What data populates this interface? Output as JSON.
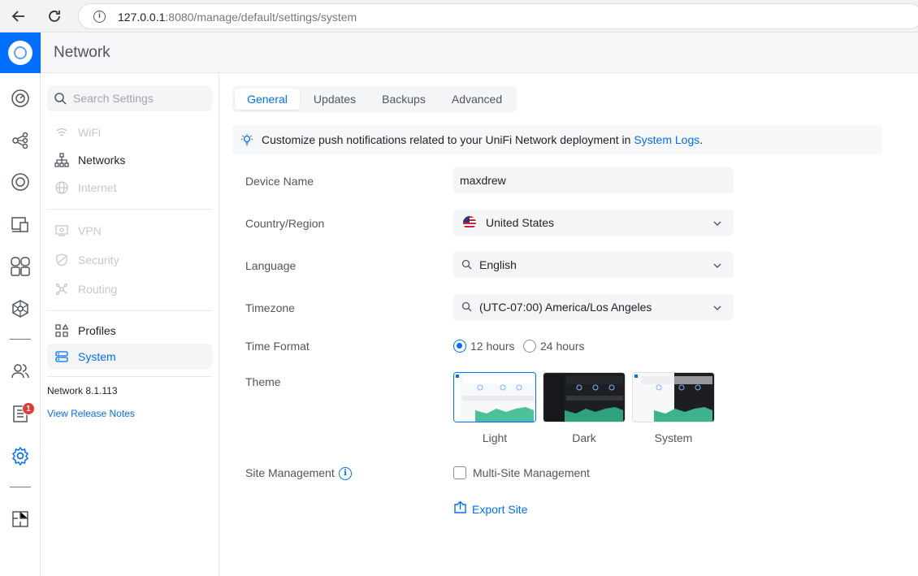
{
  "browser": {
    "url_host": "127.0.0.1",
    "url_rest": ":8080/manage/default/settings/system"
  },
  "header": {
    "title": "Network"
  },
  "rail": {
    "icons": [
      "dashboard-icon",
      "topology-icon",
      "clients-target-icon",
      "devices-icon",
      "insights-icon",
      "integrations-icon",
      "admins-icon",
      "system-log-icon",
      "settings-icon",
      "innerspace-icon"
    ],
    "notification_count": "1"
  },
  "sidebar": {
    "search_placeholder": "Search Settings",
    "items": [
      {
        "label": "WiFi",
        "state": "disabled"
      },
      {
        "label": "Networks",
        "state": "normal"
      },
      {
        "label": "Internet",
        "state": "disabled"
      },
      {
        "label": "VPN",
        "state": "disabled"
      },
      {
        "label": "Security",
        "state": "disabled"
      },
      {
        "label": "Routing",
        "state": "disabled"
      },
      {
        "label": "Profiles",
        "state": "normal"
      },
      {
        "label": "System",
        "state": "active"
      }
    ],
    "version": "Network 8.1.113",
    "release_notes": "View Release Notes"
  },
  "tabs": [
    {
      "label": "General",
      "active": true
    },
    {
      "label": "Updates",
      "active": false
    },
    {
      "label": "Backups",
      "active": false
    },
    {
      "label": "Advanced",
      "active": false
    }
  ],
  "banner": {
    "text": "Customize push notifications related to your UniFi Network deployment in ",
    "link": "System Logs",
    "suffix": "."
  },
  "form": {
    "device_name": {
      "label": "Device Name",
      "value": "maxdrew"
    },
    "country": {
      "label": "Country/Region",
      "value": "United States"
    },
    "language": {
      "label": "Language",
      "value": "English"
    },
    "timezone": {
      "label": "Timezone",
      "value": "(UTC-07:00) America/Los Angeles"
    },
    "time_format": {
      "label": "Time Format",
      "options": [
        "12 hours",
        "24 hours"
      ],
      "selected": "12 hours"
    },
    "theme": {
      "label": "Theme",
      "options": [
        "Light",
        "Dark",
        "System"
      ],
      "selected": "Light"
    },
    "site_management": {
      "label": "Site Management",
      "checkbox_label": "Multi-Site Management",
      "checked": false
    },
    "export_label": "Export Site"
  },
  "colors": {
    "accent": "#006fff",
    "badge": "#e53939"
  }
}
